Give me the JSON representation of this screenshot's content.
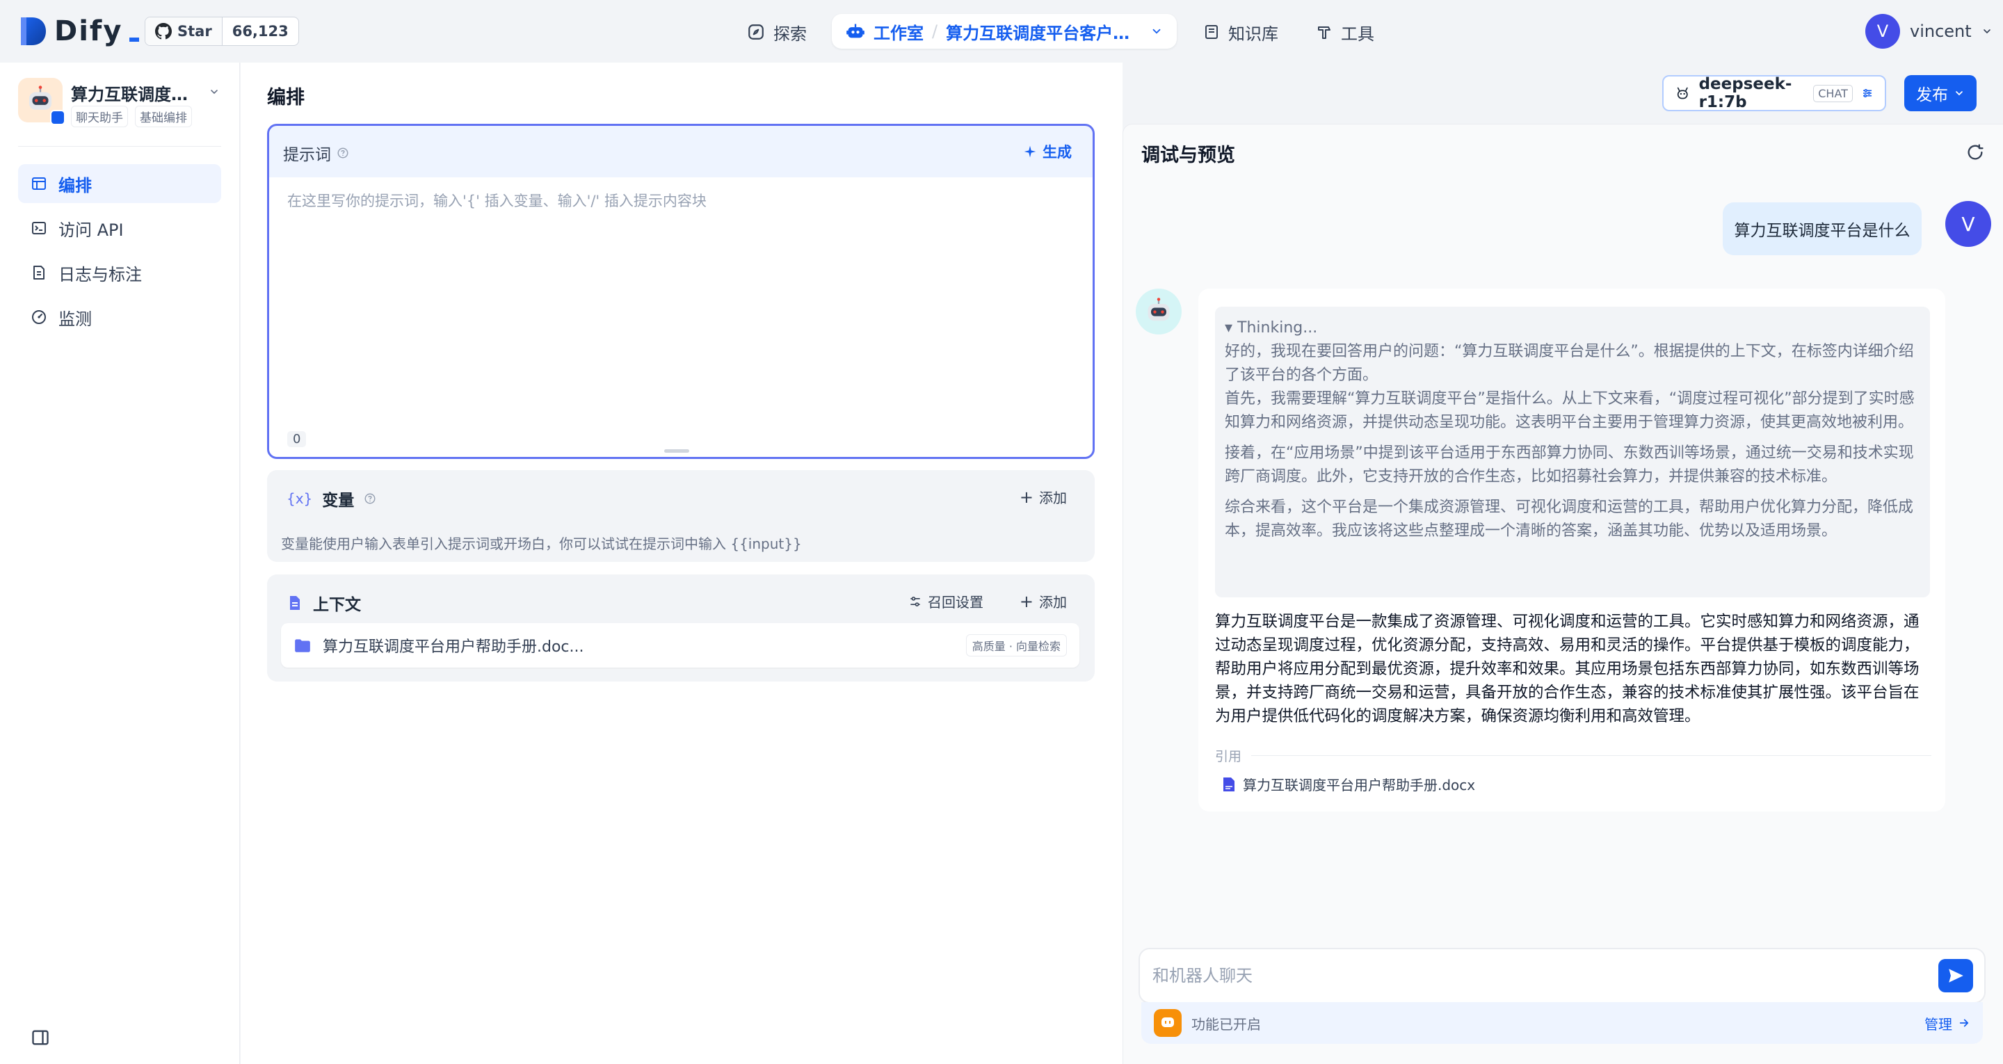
{
  "brand": {
    "name": "Dify"
  },
  "github": {
    "star_label": "Star",
    "count": "66,123"
  },
  "nav": {
    "explore": "探索",
    "workspace": "工作室",
    "app_name": "算力互联调度平台客户小...",
    "knowledge": "知识库",
    "tools": "工具"
  },
  "user": {
    "initial": "V",
    "name": "vincent"
  },
  "sidebar": {
    "app_title": "算力互联调度平...",
    "tags": [
      "聊天助手",
      "基础编排"
    ],
    "items": [
      {
        "label": "编排",
        "icon": "layout-icon",
        "active": true
      },
      {
        "label": "访问 API",
        "icon": "terminal-icon",
        "active": false
      },
      {
        "label": "日志与标注",
        "icon": "file-list-icon",
        "active": false
      },
      {
        "label": "监测",
        "icon": "dashboard-icon",
        "active": false
      }
    ]
  },
  "main": {
    "title": "编排",
    "model": {
      "name": "deepseek-r1:7b",
      "badge": "CHAT"
    },
    "publish": "发布",
    "prompt": {
      "label": "提示词",
      "generate": "生成",
      "placeholder": "在这里写你的提示词，输入'{' 插入变量、输入'/' 插入提示内容块",
      "count": "0"
    },
    "variables": {
      "title": "变量",
      "add": "添加",
      "description": "变量能使用户输入表单引入提示词或开场白，你可以试试在提示词中输入 {{input}}"
    },
    "context": {
      "title": "上下文",
      "retrieval_settings": "召回设置",
      "add": "添加",
      "file": "算力互联调度平台用户帮助手册.doc...",
      "badge": "高质量 · 向量检索"
    }
  },
  "preview": {
    "title": "调试与预览",
    "user_message": "算力互联调度平台是什么",
    "thinking_label": "▾ Thinking...",
    "thinking_paragraphs": [
      "好的，我现在要回答用户的问题：“算力互联调度平台是什么”。根据提供的上下文，在标签内详细介绍了该平台的各个方面。\n首先，我需要理解“算力互联调度平台”是指什么。从上下文来看，“调度过程可视化”部分提到了实时感知算力和网络资源，并提供动态呈现功能。这表明平台主要用于管理算力资源，使其更高效地被利用。",
      "接着，在“应用场景”中提到该平台适用于东西部算力协同、东数西训等场景，通过统一交易和技术实现跨厂商调度。此外，它支持开放的合作生态，比如招募社会算力，并提供兼容的技术标准。",
      "综合来看，这个平台是一个集成资源管理、可视化调度和运营的工具，帮助用户优化算力分配，降低成本，提高效率。我应该将这些点整理成一个清晰的答案，涵盖其功能、优势以及适用场景。"
    ],
    "answer": "算力互联调度平台是一款集成了资源管理、可视化调度和运营的工具。它实时感知算力和网络资源，通过动态呈现调度过程，优化资源分配，支持高效、易用和灵活的操作。平台提供基于模板的调度能力，帮助用户将应用分配到最优资源，提升效率和效果。其应用场景包括东西部算力协同，如东数西训等场景，并支持跨厂商统一交易和运营，具备开放的合作生态，兼容的技术标准使其扩展性强。该平台旨在为用户提供低代码化的调度解决方案，确保资源均衡利用和高效管理。",
    "citation_label": "引用",
    "citation_file": "算力互联调度平台用户帮助手册.docx",
    "input_placeholder": "和机器人聊天",
    "feature_status": "功能已开启",
    "manage": "管理"
  },
  "colors": {
    "primary": "#155eef",
    "accent": "#6172f3"
  }
}
